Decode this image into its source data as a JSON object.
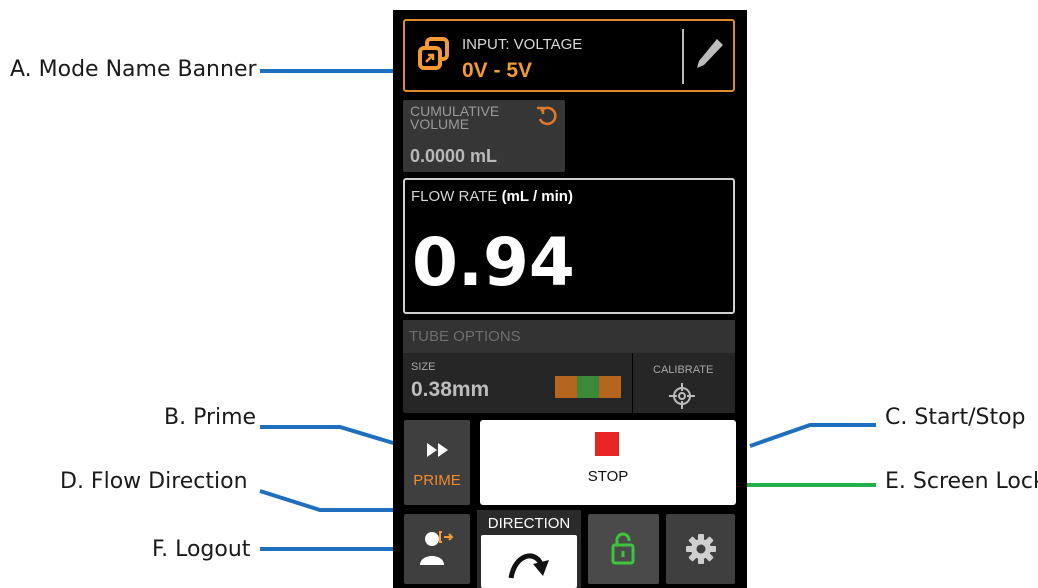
{
  "callouts": {
    "mode_banner": "A. Mode Name Banner",
    "prime": "B. Prime",
    "start_stop": "C. Start/Stop",
    "flow_direction": "D. Flow Direction",
    "screen_lock": "E. Screen Lock",
    "logout": "F. Logout"
  },
  "banner": {
    "label": "INPUT: VOLTAGE",
    "value": "0V - 5V",
    "icon": "mode-window-icon",
    "edit_icon": "pencil-icon"
  },
  "cumulative": {
    "label": "CUMULATIVE VOLUME",
    "value": "0.0000 mL",
    "icon": "reset-icon"
  },
  "flow": {
    "label": "FLOW RATE",
    "unit": "(mL / min)",
    "value": "0.94"
  },
  "tube": {
    "title": "TUBE OPTIONS",
    "size_label": "SIZE",
    "size_value": "0.38mm",
    "calibrate_label": "CALIBRATE",
    "color_bands": [
      "#b5651d",
      "#3a8a3a",
      "#b5651d"
    ]
  },
  "buttons": {
    "prime_label": "PRIME",
    "stop_label": "STOP",
    "direction_label": "DIRECTION"
  },
  "colors": {
    "accent_orange": "#f29a33",
    "stop_red": "#e82424",
    "lock_green": "#3fc43f",
    "leader_blue": "#1f6fbf"
  }
}
